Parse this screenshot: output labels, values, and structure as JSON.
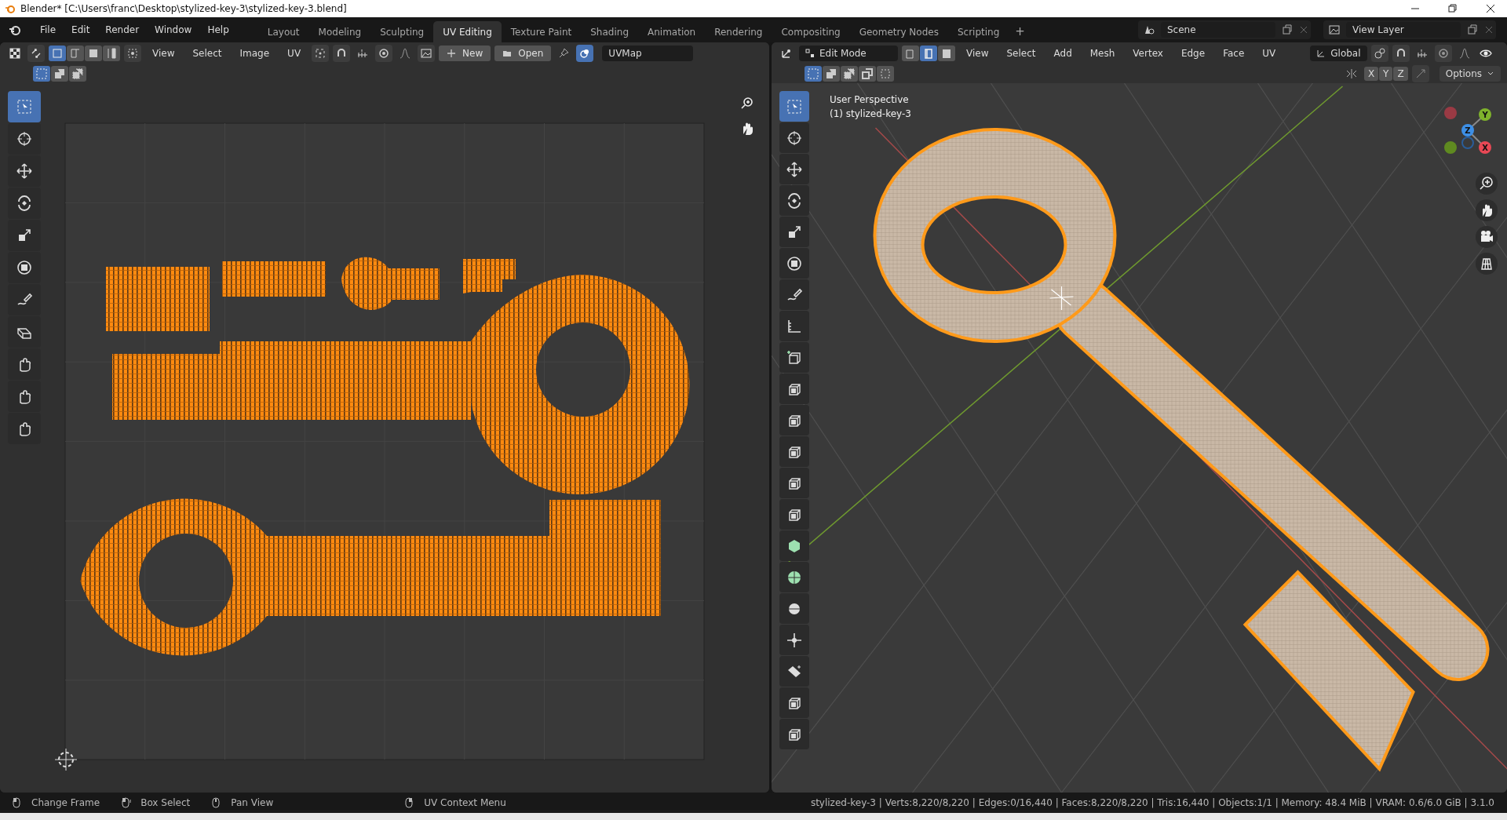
{
  "title_bar": {
    "title": "Blender* [C:\\Users\\franc\\Desktop\\stylized-key-3\\stylized-key-3.blend]"
  },
  "menu": [
    "File",
    "Edit",
    "Render",
    "Window",
    "Help"
  ],
  "workspaces": [
    {
      "label": "Layout",
      "selected": false
    },
    {
      "label": "Modeling",
      "selected": false
    },
    {
      "label": "Sculpting",
      "selected": false
    },
    {
      "label": "UV Editing",
      "selected": true
    },
    {
      "label": "Texture Paint",
      "selected": false
    },
    {
      "label": "Shading",
      "selected": false
    },
    {
      "label": "Animation",
      "selected": false
    },
    {
      "label": "Rendering",
      "selected": false
    },
    {
      "label": "Compositing",
      "selected": false
    },
    {
      "label": "Geometry Nodes",
      "selected": false
    },
    {
      "label": "Scripting",
      "selected": false
    }
  ],
  "add_workspace": "+",
  "scene": "Scene",
  "view_layer": "View Layer",
  "uv_editor": {
    "select_modes": [
      {
        "kind": "vertex",
        "selected": true
      },
      {
        "kind": "edge",
        "selected": false
      },
      {
        "kind": "face",
        "selected": false
      },
      {
        "kind": "island",
        "selected": false
      }
    ],
    "menus": [
      "View",
      "Select",
      "Image",
      "UV"
    ],
    "new_button": "New",
    "open_button": "Open",
    "uv_map": "UVMap",
    "box_modes": [
      {
        "kind": "set",
        "selected": true
      },
      {
        "kind": "extend",
        "selected": false
      },
      {
        "kind": "subtract",
        "selected": false
      }
    ],
    "tools": [
      {
        "kind": "select",
        "selected": true
      },
      {
        "kind": "cursor",
        "selected": false
      },
      {
        "kind": "move",
        "selected": false
      },
      {
        "kind": "rotate",
        "selected": false
      },
      {
        "kind": "scale",
        "selected": false
      },
      {
        "kind": "transform",
        "selected": false
      },
      {
        "kind": "annotate",
        "selected": false
      },
      {
        "kind": "rip",
        "selected": false
      },
      {
        "kind": "grab",
        "selected": false
      },
      {
        "kind": "relax",
        "selected": false
      },
      {
        "kind": "pinch",
        "selected": false
      }
    ]
  },
  "viewport": {
    "mode": "Edit Mode",
    "select_modes": [
      {
        "kind": "vertex",
        "selected": false
      },
      {
        "kind": "edge",
        "selected": true
      },
      {
        "kind": "face",
        "selected": false
      }
    ],
    "menus": [
      "View",
      "Select",
      "Add",
      "Mesh",
      "Vertex",
      "Edge",
      "Face",
      "UV"
    ],
    "orientation": "Global",
    "box_modes": [
      {
        "kind": "set",
        "selected": true
      },
      {
        "kind": "extend",
        "selected": false
      },
      {
        "kind": "subtract",
        "selected": false
      },
      {
        "kind": "invert",
        "selected": false
      },
      {
        "kind": "intersect",
        "selected": false
      }
    ],
    "axis_buttons": [
      "X",
      "Y",
      "Z"
    ],
    "options": "Options",
    "overlay_lines": [
      "User Perspective",
      "(1) stylized-key-3"
    ],
    "gizmo": [
      {
        "label": "Y",
        "color": "#7fb32c"
      },
      {
        "label": "Z",
        "color": "#3d8fe6"
      },
      {
        "label": "X",
        "color": "#e84855"
      }
    ],
    "tools": [
      {
        "kind": "select",
        "selected": true
      },
      {
        "kind": "cursor",
        "selected": false
      },
      {
        "kind": "move",
        "selected": false
      },
      {
        "kind": "rotate",
        "selected": false
      },
      {
        "kind": "scale",
        "selected": false
      },
      {
        "kind": "transform",
        "selected": false
      },
      {
        "kind": "annotate",
        "selected": false
      },
      {
        "kind": "measure",
        "selected": false
      },
      {
        "kind": "add-cube",
        "selected": false
      },
      {
        "kind": "extrude",
        "selected": false
      },
      {
        "kind": "inset",
        "selected": false
      },
      {
        "kind": "bevel",
        "selected": false
      },
      {
        "kind": "loop-cut",
        "selected": false
      },
      {
        "kind": "knife",
        "selected": false
      },
      {
        "kind": "poly-build",
        "selected": false
      },
      {
        "kind": "spin",
        "selected": false
      },
      {
        "kind": "smooth",
        "selected": false
      },
      {
        "kind": "edge-slide",
        "selected": false
      },
      {
        "kind": "shrink",
        "selected": false
      },
      {
        "kind": "shear",
        "selected": false
      },
      {
        "kind": "rip",
        "selected": false
      }
    ]
  },
  "status_bar": {
    "hints": [
      {
        "kind": "left",
        "label": "Change Frame"
      },
      {
        "kind": "drag",
        "label": "Box Select"
      },
      {
        "kind": "middle",
        "label": "Pan View"
      },
      {
        "kind": "right",
        "label": "UV Context Menu"
      }
    ],
    "stats": "stylized-key-3 | Verts:8,220/8,220 | Edges:0/16,440 | Faces:8,220/8,220 | Tris:16,440 | Objects:1/1 | Memory: 48.4 MiB | VRAM: 0.6/6.0 GiB | 3.1.0"
  }
}
